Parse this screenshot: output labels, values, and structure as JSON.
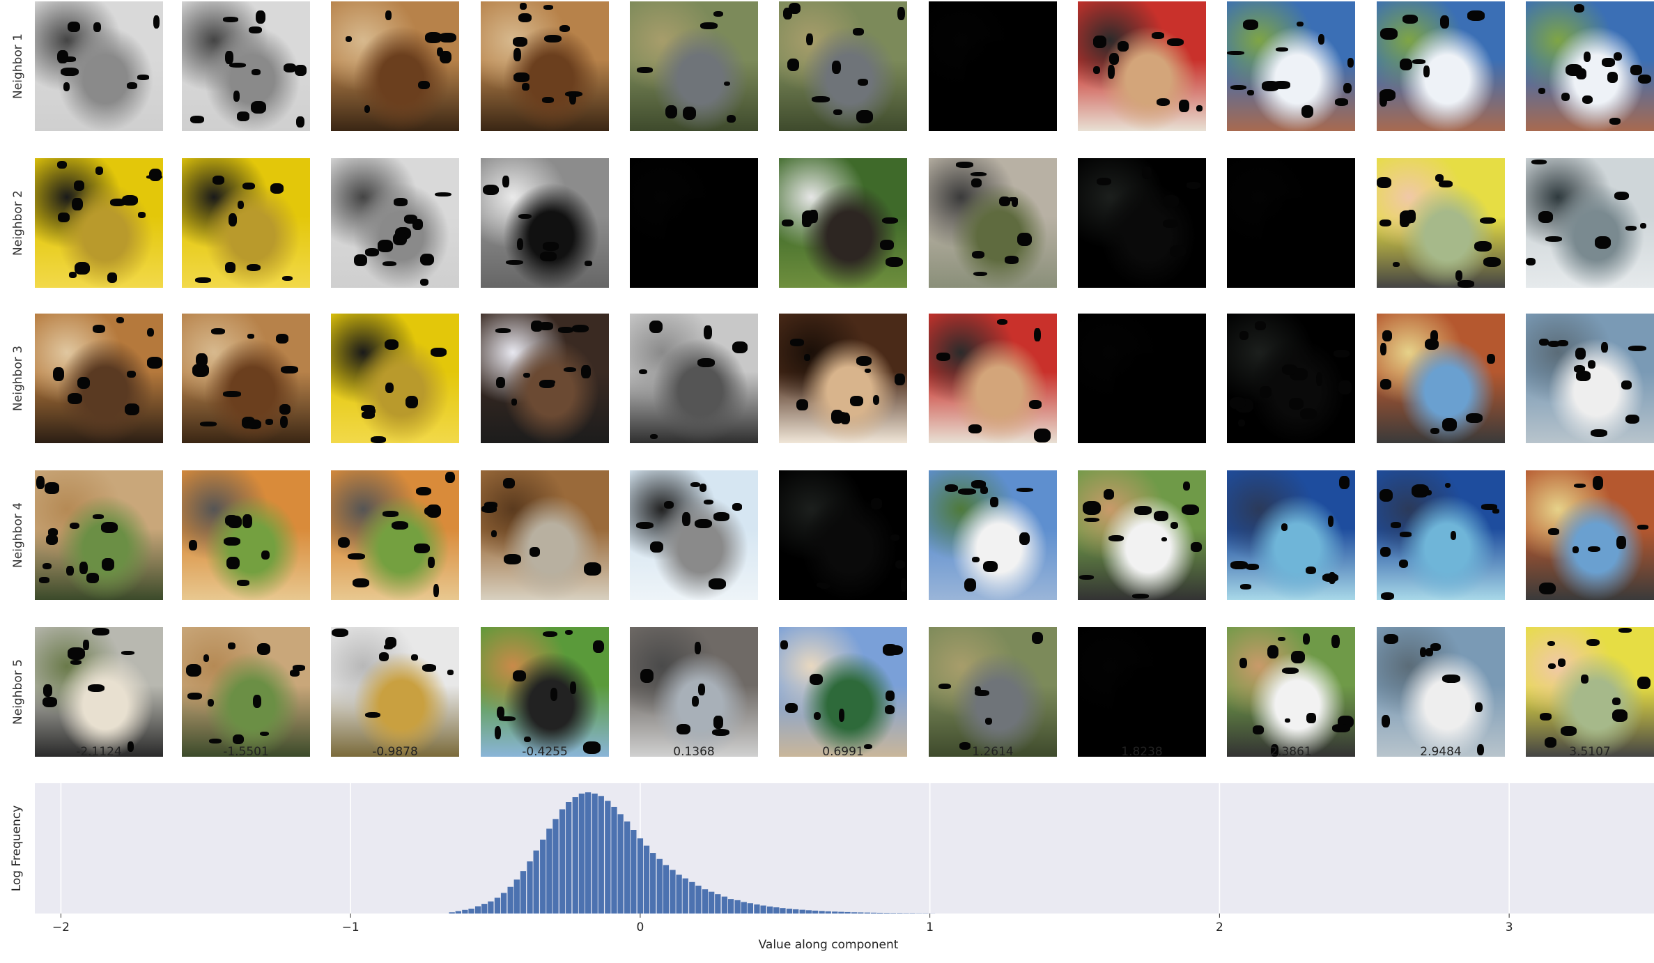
{
  "row_labels": [
    "Neighbor 1",
    "Neighbor 2",
    "Neighbor 3",
    "Neighbor 4",
    "Neighbor 5"
  ],
  "column_labels": [
    "-2.1124",
    "-1.5501",
    "-0.9878",
    "-0.4255",
    "0.1368",
    "0.6991",
    "1.2614",
    "1.8238",
    "2.3861",
    "2.9484",
    "3.5107"
  ],
  "neighbor_images": [
    [
      "weightlifter in gym",
      "weightlifter in gym",
      "fluffy brown dog lying",
      "fluffy brown dog lying",
      "gray dog in grass",
      "gray dog in grass",
      "black image",
      "people with trumpet",
      "barn under cloudy sky",
      "barn under cloudy sky",
      "barn under cloudy sky"
    ],
    [
      "kettle on yellow stove",
      "kettle on yellow stove",
      "weightlifter in gym",
      "black and white puppy",
      "black image",
      "dog with ball on grass",
      "dogs on path",
      "dark speckled image",
      "black image",
      "girl on railing",
      "ship in gray sky"
    ],
    [
      "dog lying on floor",
      "fluffy brown dog lying",
      "kettle on yellow stove",
      "dog with plate",
      "people pulling rickshaw",
      "small dog close-up",
      "people with trumpet",
      "black image",
      "dark speckled image",
      "shop front",
      "sailboat in harbor"
    ],
    [
      "cougar lying in grass",
      "fox on grill",
      "fox on grill",
      "brown dog standing",
      "pelican in flight",
      "dark speckled image",
      "white pagoda",
      "boy with telescope",
      "sea turtle underwater",
      "sea turtle underwater",
      "shop front"
    ],
    [
      "white dog lying",
      "cougar lying in grass",
      "bottle and glasses",
      "dog lying on lawn",
      "elephant with people",
      "mosque with green dome",
      "gray dog in grass",
      "black image",
      "boy with telescope",
      "sailboat in harbor",
      "girl on railing"
    ]
  ],
  "chart_data": {
    "type": "bar",
    "title": "",
    "xlabel": "Value along component",
    "ylabel": "Log Frequency",
    "xlim": [
      -2.09,
      3.5
    ],
    "xticks": [
      -2,
      -1,
      0,
      1,
      2,
      3
    ],
    "xtick_labels": [
      "−2",
      "−1",
      "0",
      "1",
      "2",
      "3"
    ],
    "bin_width": 0.0224,
    "bin_starts": [
      -0.66,
      -0.638,
      -0.615,
      -0.593,
      -0.57,
      -0.548,
      -0.526,
      -0.503,
      -0.481,
      -0.458,
      -0.436,
      -0.414,
      -0.391,
      -0.369,
      -0.346,
      -0.324,
      -0.302,
      -0.279,
      -0.257,
      -0.234,
      -0.212,
      -0.19,
      -0.167,
      -0.145,
      -0.122,
      -0.1,
      -0.078,
      -0.055,
      -0.033,
      -0.01,
      0.012,
      0.034,
      0.057,
      0.079,
      0.102,
      0.124,
      0.146,
      0.169,
      0.191,
      0.214,
      0.236,
      0.258,
      0.281,
      0.303,
      0.326,
      0.348,
      0.37,
      0.393,
      0.415,
      0.438,
      0.46,
      0.482,
      0.505,
      0.527,
      0.55,
      0.572,
      0.594,
      0.617,
      0.639,
      0.662,
      0.684,
      0.706,
      0.729,
      0.751,
      0.774,
      0.796,
      0.818,
      0.841,
      0.863,
      0.886,
      0.908,
      0.93,
      0.953,
      0.975,
      0.998
    ],
    "values": [
      0.01,
      0.02,
      0.03,
      0.04,
      0.06,
      0.08,
      0.1,
      0.13,
      0.17,
      0.22,
      0.28,
      0.35,
      0.43,
      0.52,
      0.61,
      0.7,
      0.78,
      0.86,
      0.92,
      0.96,
      0.99,
      1.0,
      0.99,
      0.97,
      0.93,
      0.88,
      0.82,
      0.76,
      0.69,
      0.62,
      0.56,
      0.5,
      0.45,
      0.4,
      0.36,
      0.32,
      0.29,
      0.26,
      0.23,
      0.2,
      0.18,
      0.16,
      0.14,
      0.12,
      0.11,
      0.095,
      0.085,
      0.075,
      0.066,
      0.058,
      0.051,
      0.045,
      0.04,
      0.035,
      0.031,
      0.027,
      0.024,
      0.021,
      0.018,
      0.016,
      0.014,
      0.012,
      0.01,
      0.009,
      0.008,
      0.007,
      0.006,
      0.005,
      0.004,
      0.004,
      0.003,
      0.003,
      0.002,
      0.002,
      0.001
    ],
    "bar_color": "#4c72b0",
    "background": "#eaeaf2",
    "grid": true
  }
}
